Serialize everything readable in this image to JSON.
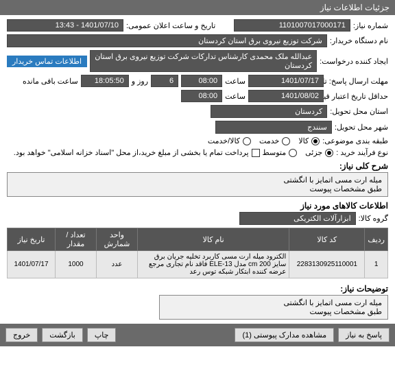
{
  "header": {
    "title": "جزئیات اطلاعات نیاز"
  },
  "form": {
    "need_no_label": "شماره نیاز:",
    "need_no": "1101007017000171",
    "announce_label": "تاریخ و ساعت اعلان عمومی:",
    "announce_value": "1401/07/10 - 13:43",
    "buyer_label": "نام دستگاه خریدار:",
    "buyer": "شرکت توزیع نیروی برق استان کردستان",
    "requester_label": "ایجاد کننده درخواست:",
    "requester": "عبدالله ملک محمدی کارشناس تدارکات شرکت توزیع نیروی برق استان کردستان",
    "contact_btn": "اطلاعات تماس خریدار",
    "deadline_label": "مهلت ارسال پاسخ: تا تاریخ:",
    "deadline_date": "1401/07/17",
    "time_label": "ساعت",
    "deadline_time": "08:00",
    "day_label": "روز و",
    "days_remain": "6",
    "countdown": "18:05:50",
    "remain_label": "ساعت باقی مانده",
    "validity_label": "حداقل تاریخ اعتبار قیمت: تا تاریخ:",
    "validity_date": "1401/08/02",
    "validity_time": "08:00",
    "province_label": "استان محل تحویل:",
    "province": "کردستان",
    "city_label": "شهر محل تحویل:",
    "city": "سنندج",
    "category_label": "طبقه بندی موضوعی:",
    "cat_goods": "کالا",
    "cat_service": "خدمت",
    "cat_both": "کالا/خدمت",
    "process_label": "نوع فرآیند خرید :",
    "proc_partial": "جزئی",
    "proc_medium": "متوسط",
    "payment_note": "پرداخت تمام یا بخشی از مبلغ خرید،از محل \"اسناد خزانه اسلامی\" خواهد بود.",
    "desc_title": "شرح کلی نیاز:",
    "desc_text": "میله ارت مسی اتمایز با انگشتی\nطبق مشخصات پیوست",
    "items_title": "اطلاعات کالاهای مورد نیاز",
    "group_label": "گروه کالا:",
    "group": "ابزارآلات الکتریکی",
    "notes_title": "توضیحات نیاز:",
    "notes_text": "میله ارت مسی اتمایز با انگشتی\nطبق مشخصات پیوست"
  },
  "table": {
    "headers": {
      "row": "ردیف",
      "code": "کد کالا",
      "name": "نام کالا",
      "unit": "واحد شمارش",
      "qty": "تعداد / مقدار",
      "date": "تاریخ نیاز"
    },
    "rows": [
      {
        "row": "1",
        "code": "2283130925110001",
        "name": "الکترود میله ارت مسی کاربرد تخلیه جریان برق سایز cm 200 مدل ELE-13 فاقد نام تجاری مرجع عرضه کننده ابتکار شبکه توس رعد",
        "unit": "عدد",
        "qty": "1000",
        "date": "1401/07/17"
      }
    ]
  },
  "footer": {
    "back": "پاسخ به نیاز",
    "attachments": "مشاهده مدارک پیوستی (1)",
    "print": "چاپ",
    "return": "بازگشت",
    "exit": "خروج"
  }
}
